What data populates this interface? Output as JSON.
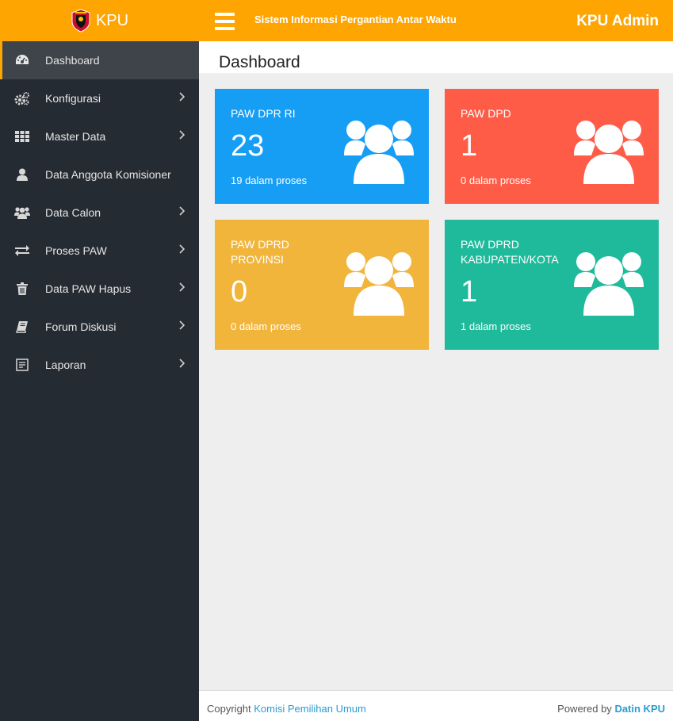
{
  "brand": {
    "name": "KPU"
  },
  "header": {
    "title": "Sistem Informasi Pergantian Antar Waktu",
    "user": "KPU Admin"
  },
  "sidebar": {
    "items": [
      {
        "label": "Dashboard",
        "icon": "dashboard-icon",
        "active": true,
        "chevron": false
      },
      {
        "label": "Konfigurasi",
        "icon": "gears-icon",
        "chevron": true
      },
      {
        "label": "Master Data",
        "icon": "grid-icon",
        "chevron": true
      },
      {
        "label": "Data Anggota Komisioner",
        "icon": "user-icon",
        "chevron": false
      },
      {
        "label": "Data Calon",
        "icon": "users-icon",
        "chevron": true
      },
      {
        "label": "Proses PAW",
        "icon": "exchange-icon",
        "chevron": true
      },
      {
        "label": "Data PAW Hapus",
        "icon": "trash-icon",
        "chevron": true
      },
      {
        "label": "Forum Diskusi",
        "icon": "book-icon",
        "chevron": true
      },
      {
        "label": "Laporan",
        "icon": "report-icon",
        "chevron": true
      }
    ]
  },
  "page": {
    "title": "Dashboard"
  },
  "cards": [
    {
      "title": "PAW DPR RI",
      "count": "23",
      "sub": "19 dalam proses",
      "color": "#169ef5"
    },
    {
      "title": "PAW DPD",
      "count": "1",
      "sub": "0 dalam proses",
      "color": "#ff5c48"
    },
    {
      "title": "PAW DPRD PROVINSI",
      "count": "0",
      "sub": "0 dalam proses",
      "color": "#f2b53c"
    },
    {
      "title": "PAW DPRD KABUPATEN/KOTA",
      "count": "1",
      "sub": "1 dalam proses",
      "color": "#1fba9b"
    }
  ],
  "footer": {
    "copyright_prefix": "Copyright",
    "copyright_link": "Komisi Pemilihan Umum",
    "powered_prefix": "Powered by",
    "powered_by": "Datin KPU"
  }
}
